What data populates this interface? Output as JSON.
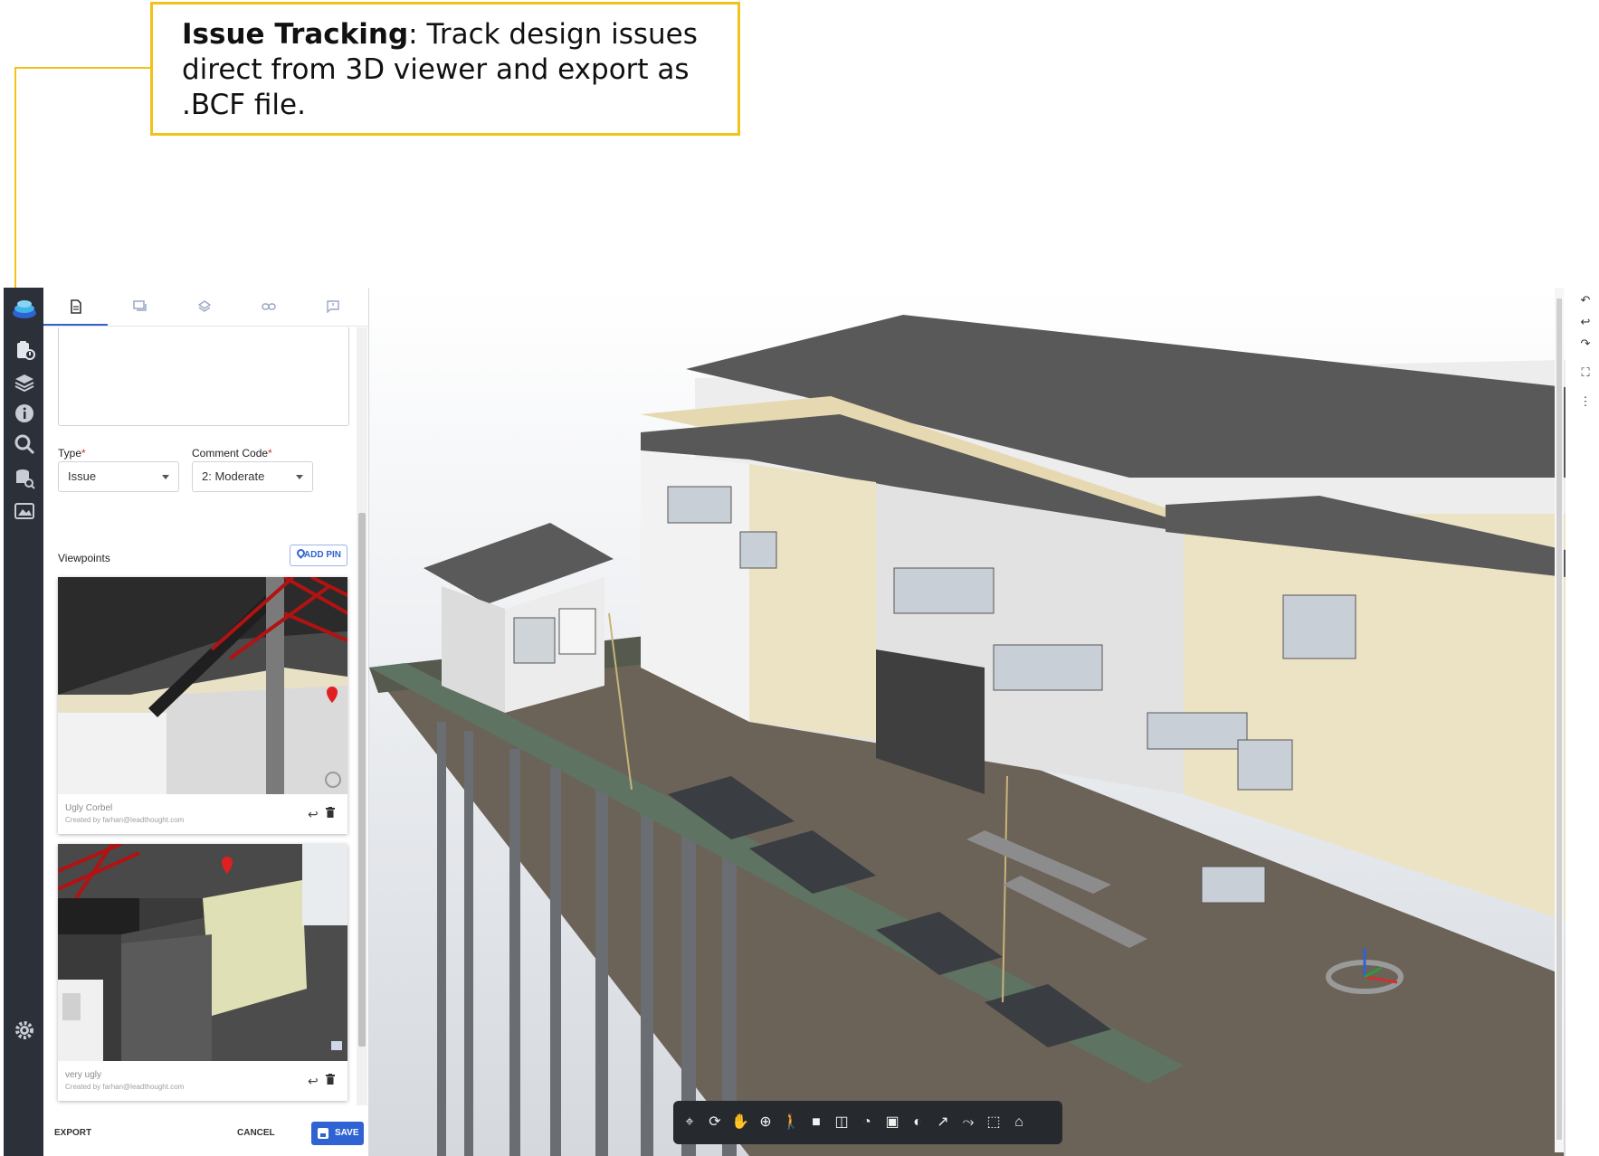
{
  "callout": {
    "title": "Issue Tracking",
    "body": ": Track design issues direct from 3D viewer and export as .BCF file."
  },
  "rail": {
    "icons": [
      "app-logo-icon",
      "issues-icon",
      "layers-icon",
      "info-icon",
      "search-icon",
      "database-search-icon",
      "gallery-icon",
      "settings-icon"
    ]
  },
  "panel": {
    "tabs": [
      "details-tab",
      "comments-tab",
      "layers-tab",
      "links-tab",
      "feedback-tab"
    ],
    "form": {
      "type_label": "Type",
      "type_value": "Issue",
      "code_label": "Comment Code",
      "code_value": "2: Moderate",
      "required_mark": "*"
    },
    "viewpoints": {
      "label": "Viewpoints",
      "add_pin": "ADD PIN",
      "items": [
        {
          "title": "Ugly Corbel",
          "created_by": "Created by farhan@leadthought.com"
        },
        {
          "title": "very ugly",
          "created_by": "Created by farhan@leadthought.com"
        }
      ]
    },
    "footer": {
      "export": "EXPORT",
      "cancel": "CANCEL",
      "save": "SAVE"
    }
  },
  "colors": {
    "accent": "#2f63d3",
    "callout_border": "#f2c21b",
    "rail_bg": "#2c3038",
    "toolbar_bg": "#26292e"
  },
  "viewer": {
    "toolbar_icons": [
      "fit-view-icon",
      "orbit-icon",
      "pan-icon",
      "zoom-icon",
      "walk-icon",
      "camera-icon",
      "section-icon",
      "measure-icon",
      "area-icon",
      "transparency-icon",
      "explode-icon",
      "axes-icon",
      "selection-box-icon",
      "home-icon"
    ],
    "right_tools": [
      "undo-icon",
      "undo-alt-icon",
      "redo-icon",
      "fullscreen-icon",
      "more-icon"
    ]
  }
}
